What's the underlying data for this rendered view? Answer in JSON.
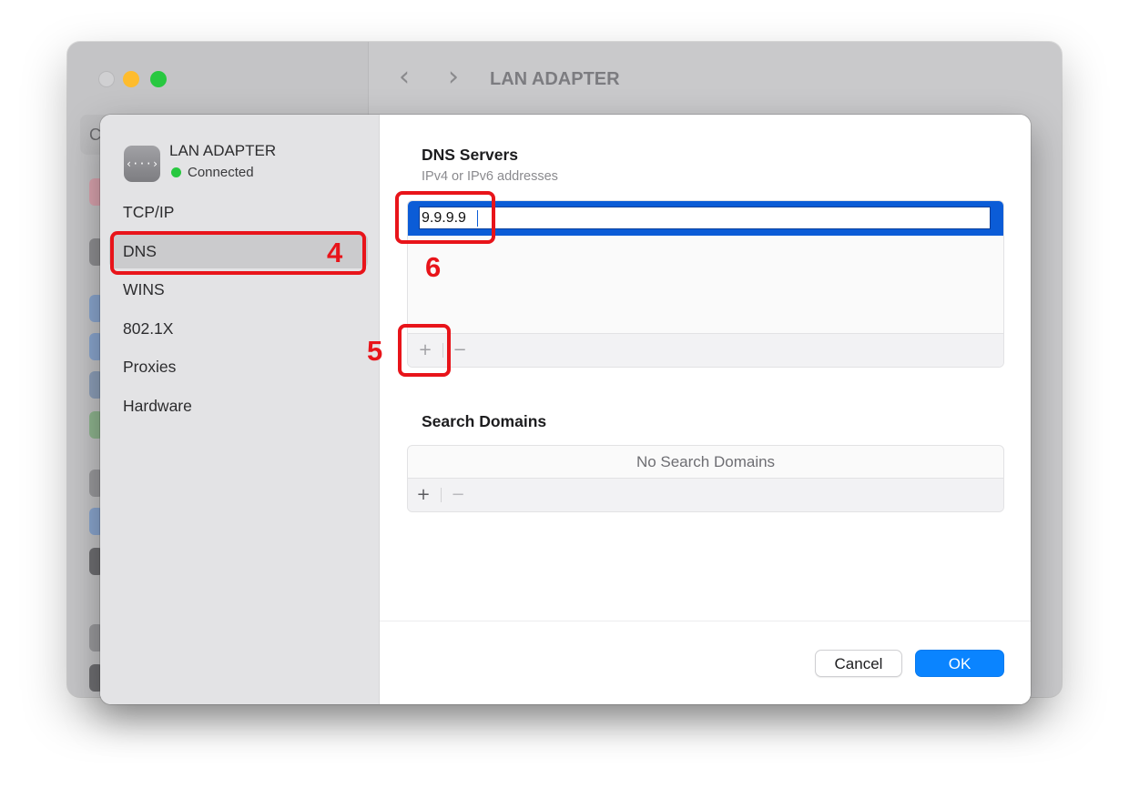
{
  "background_window": {
    "title": "LAN ADAPTER",
    "nav_back_glyph": "‹",
    "nav_forward_glyph": "›",
    "search_stub_glyph": "C"
  },
  "sidebar": {
    "adapter_name": "LAN ADAPTER",
    "adapter_icon_glyph": "‹···›",
    "status": "Connected",
    "status_color": "#28c840",
    "items": [
      {
        "label": "TCP/IP",
        "selected": false
      },
      {
        "label": "DNS",
        "selected": true
      },
      {
        "label": "WINS",
        "selected": false
      },
      {
        "label": "802.1X",
        "selected": false
      },
      {
        "label": "Proxies",
        "selected": false
      },
      {
        "label": "Hardware",
        "selected": false
      }
    ]
  },
  "dns_servers": {
    "title": "DNS Servers",
    "subtitle": "IPv4 or IPv6 addresses",
    "editing_value": "9.9.9.9",
    "add_label": "+",
    "remove_label": "−"
  },
  "search_domains": {
    "title": "Search Domains",
    "empty_text": "No Search Domains",
    "add_label": "+",
    "remove_label": "−"
  },
  "buttons": {
    "cancel": "Cancel",
    "ok": "OK"
  },
  "annotations": {
    "dns_step": "4",
    "add_step": "5",
    "field_step": "6",
    "color": "#e8141a"
  },
  "colors": {
    "accent": "#0a84ff",
    "selection": "#0b5cd7"
  }
}
